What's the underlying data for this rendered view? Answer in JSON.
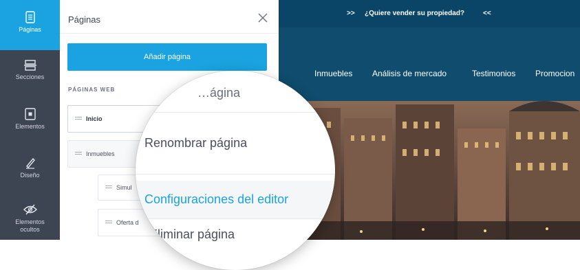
{
  "sidebar": {
    "items": [
      {
        "label": "Páginas",
        "icon": "page-icon",
        "active": true
      },
      {
        "label": "Secciones",
        "icon": "sections-icon",
        "active": false
      },
      {
        "label": "Elementos",
        "icon": "elements-icon",
        "active": false
      },
      {
        "label": "Diseño",
        "icon": "pen-icon",
        "active": false
      },
      {
        "label": "Elementos ocultos",
        "icon": "hidden-eye-icon",
        "active": false
      }
    ]
  },
  "panel": {
    "title": "Páginas",
    "add_button": "Añadir página",
    "section_label": "PÁGINAS WEB",
    "pages": [
      {
        "label": "Inicio"
      },
      {
        "label": "Inmuebles"
      },
      {
        "label": "Simul"
      },
      {
        "label": "Oferta d"
      }
    ]
  },
  "context_menu": {
    "partial_top": "…ágina",
    "items": [
      {
        "label": "Renombrar página"
      },
      {
        "label": "Configuraciones del editor"
      },
      {
        "label": "Eliminar página"
      }
    ]
  },
  "website": {
    "promo_left": ">>",
    "promo_text": "¿Quiere vender su propiedad?",
    "promo_right": "<<",
    "nav": [
      "Inmuebles",
      "Análisis de mercado",
      "Testimonios",
      "Promocion"
    ]
  },
  "colors": {
    "accent": "#1aa3e0",
    "rail": "#3d4452",
    "site_header": "#0f4c6d"
  }
}
